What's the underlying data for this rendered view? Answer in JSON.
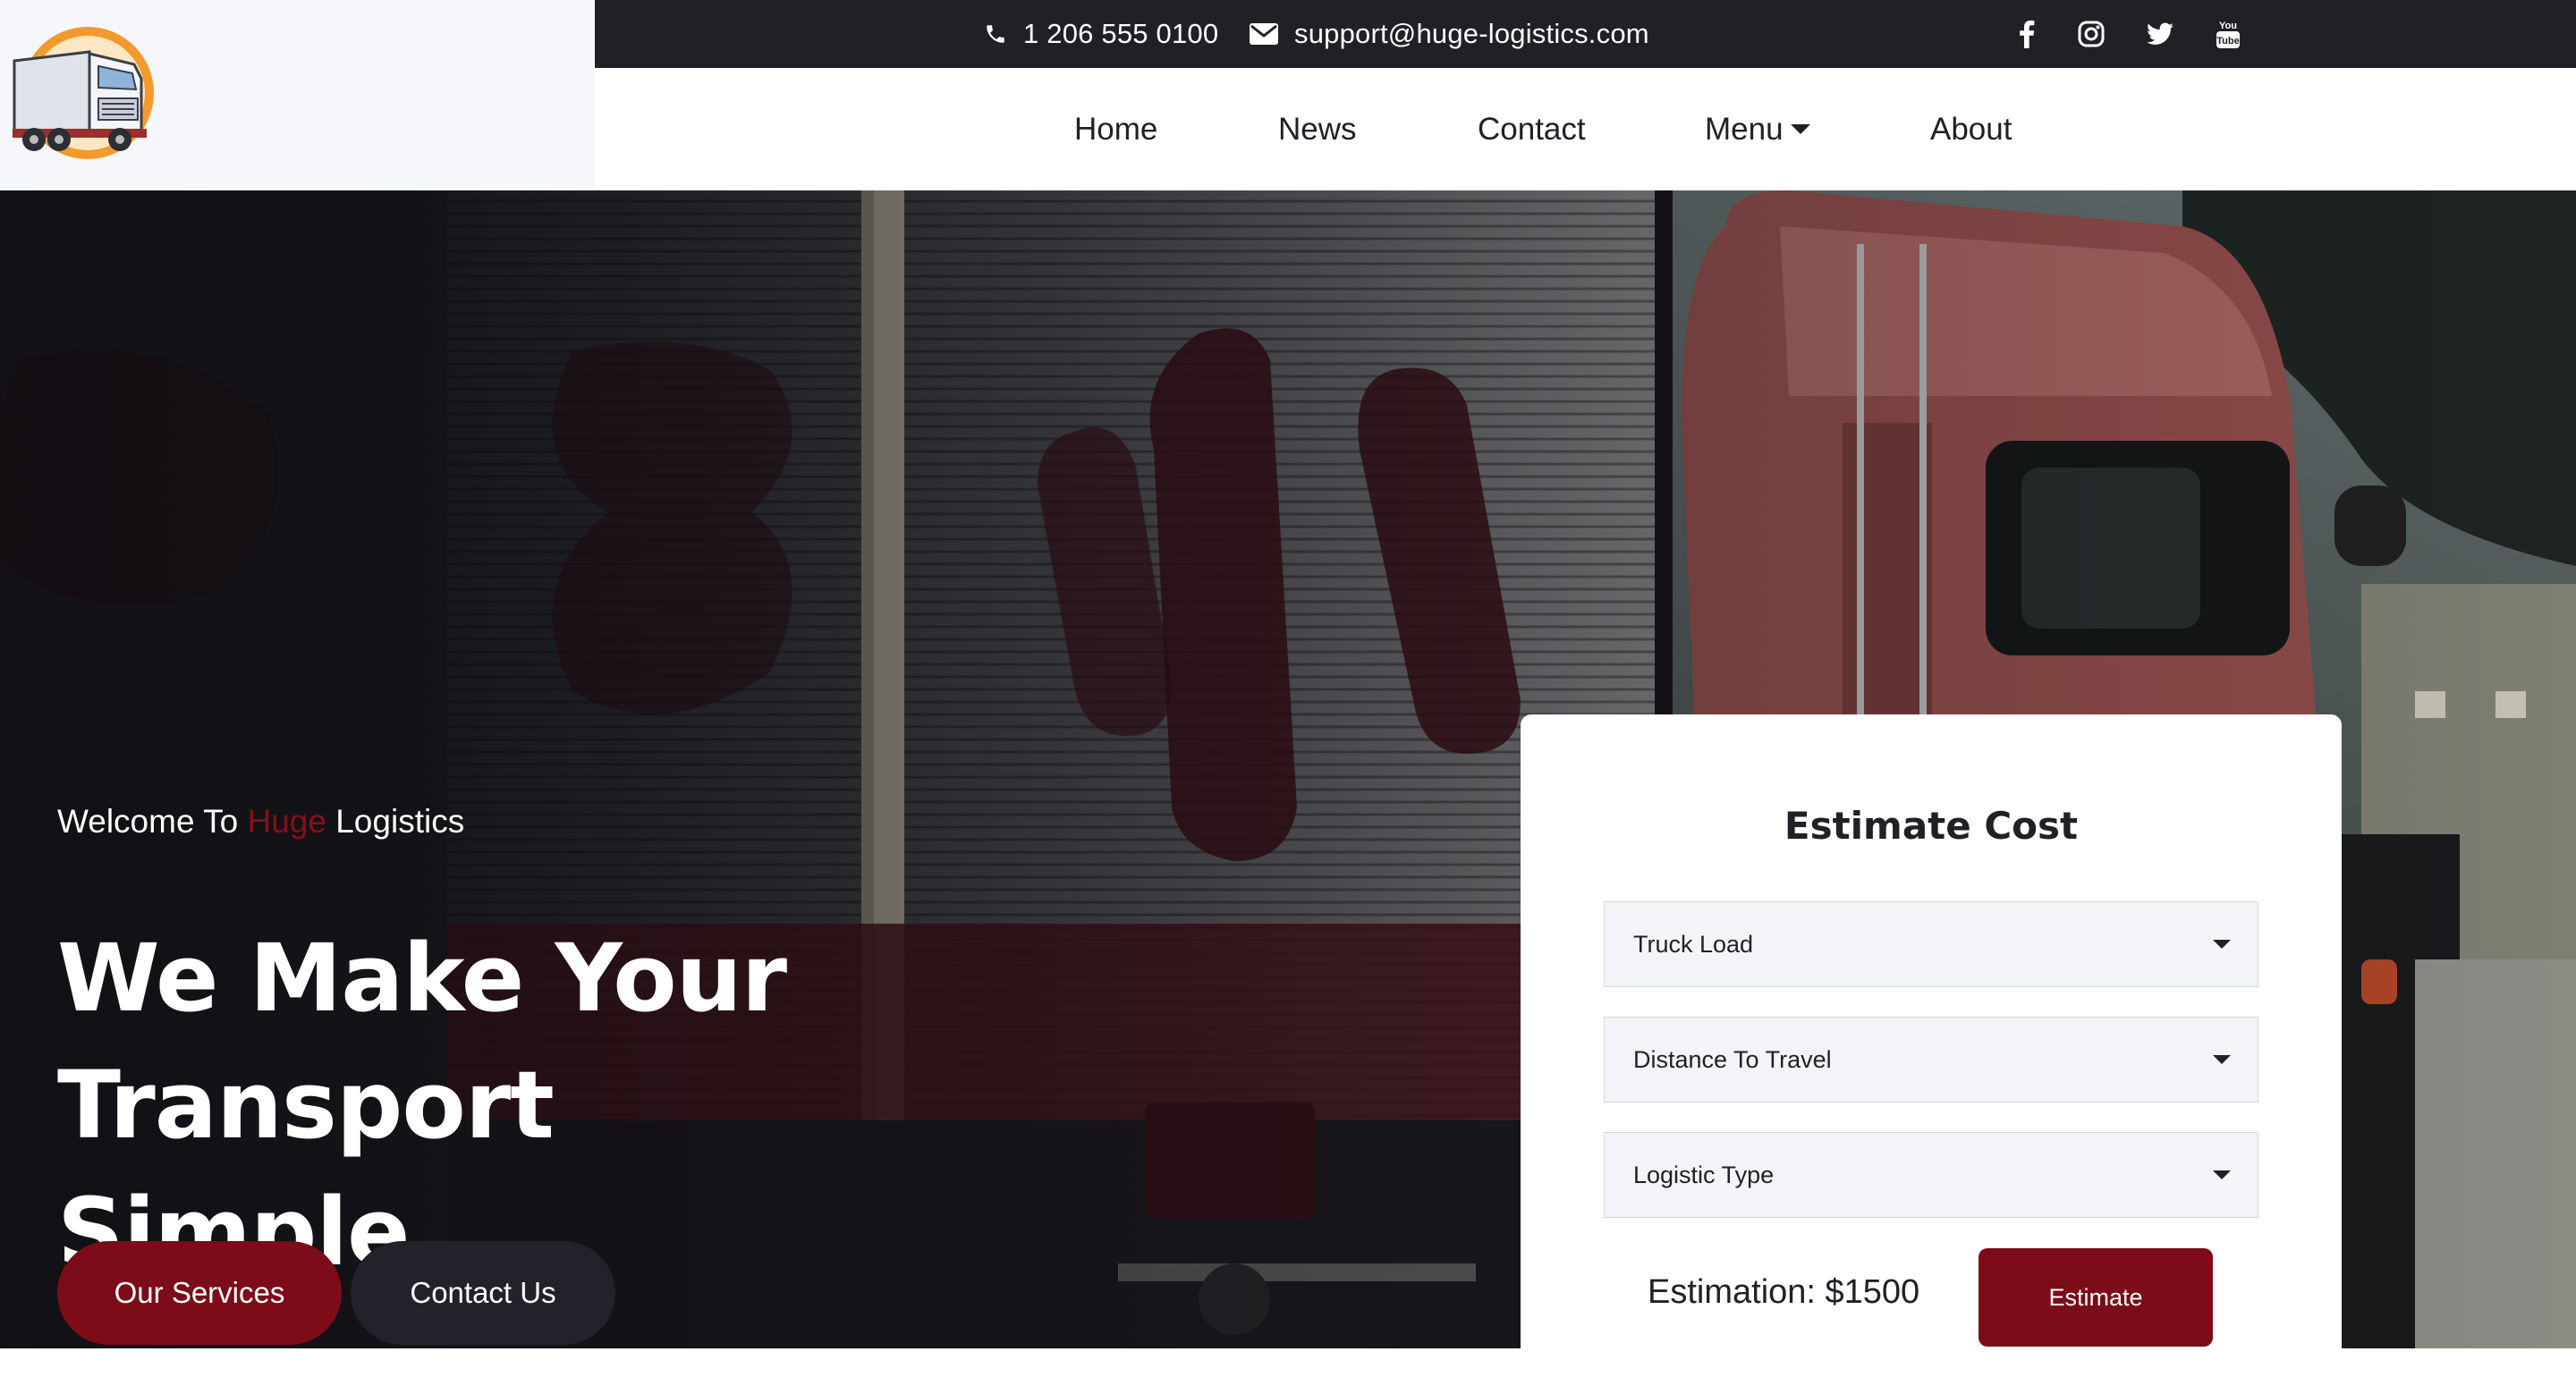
{
  "header": {
    "logo_icon": "truck-logo-icon",
    "phone": "1 206 555 0100",
    "email": "support@huge-logistics.com",
    "social": [
      "facebook-icon",
      "instagram-icon",
      "twitter-icon",
      "youtube-icon"
    ]
  },
  "nav": {
    "items": [
      {
        "label": "Home"
      },
      {
        "label": "News"
      },
      {
        "label": "Contact"
      },
      {
        "label": "Menu"
      },
      {
        "label": "About"
      }
    ]
  },
  "hero": {
    "welcome_prefix": "Welcome To",
    "welcome_brand": "Huge",
    "welcome_suffix": "Logistics",
    "headline_line1": "We Make Your Transport",
    "headline_line2": "Simple",
    "primary_button": "Our Services",
    "secondary_button": "Contact Us"
  },
  "estimate": {
    "title": "Estimate Cost",
    "selects": [
      {
        "value": "Truck Load"
      },
      {
        "value": "Distance To Travel"
      },
      {
        "value": "Logistic Type"
      }
    ],
    "estimation_text": "Estimation: $1500",
    "button": "Estimate"
  },
  "colors": {
    "accent": "#7c0c17",
    "dark": "#212027",
    "logo_bg": "#f5f7fa"
  }
}
